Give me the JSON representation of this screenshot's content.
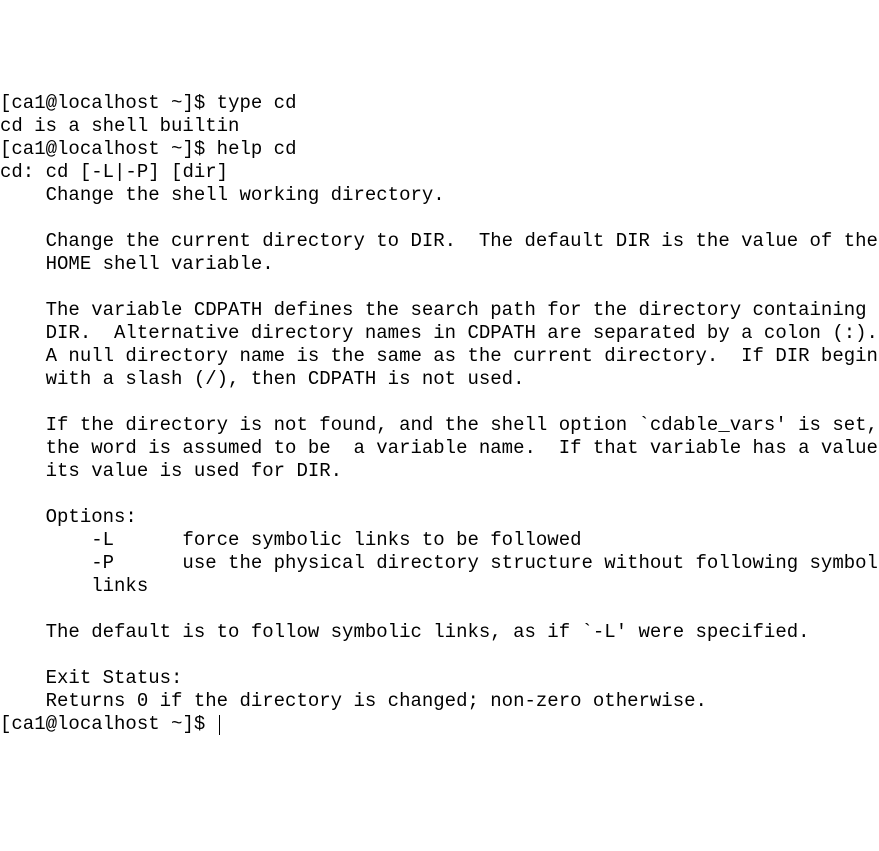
{
  "prompt": {
    "open_bracket": "[",
    "user_host": "ca1@localhost ",
    "cwd": "~",
    "close_bracket": "]",
    "dollar": "$"
  },
  "cmd1": " type cd",
  "out1": "cd is a shell builtin",
  "cmd2": " help cd",
  "help": {
    "usage_prefix": "cd: cd ",
    "usage_opts": "[-L|-P] [dir]",
    "l01": "    Change the shell working directory.",
    "l02": "    ",
    "l03": "    Change the current directory to DIR.  The default DIR is the value of the",
    "l04": "    HOME shell variable.",
    "l05": "    ",
    "l06": "    The variable CDPATH defines the search path for the directory containing",
    "l07": "    DIR.  Alternative directory names in CDPATH are separated by a colon (:).",
    "l08": "    A null directory name is the same as the current directory.  If DIR begins",
    "l09": "    with a slash (/), then CDPATH is not used.",
    "l10": "    ",
    "l11": "    If the directory is not found, and the shell option `cdable_vars' is set,",
    "l12": "    the word is assumed to be  a variable name.  If that variable has a value,",
    "l13": "    its value is used for DIR.",
    "l14": "    ",
    "l15": "    Options:",
    "l16": "        -L      force symbolic links to be followed",
    "l17": "        -P      use the physical directory structure without following symbolic",
    "l18": "        links",
    "l19": "    ",
    "l20": "    The default is to follow symbolic links, as if `-L' were specified.",
    "l21": "    ",
    "l22": "    Exit Status:",
    "l23": "    Returns 0 if the directory is changed; non-zero otherwise."
  }
}
